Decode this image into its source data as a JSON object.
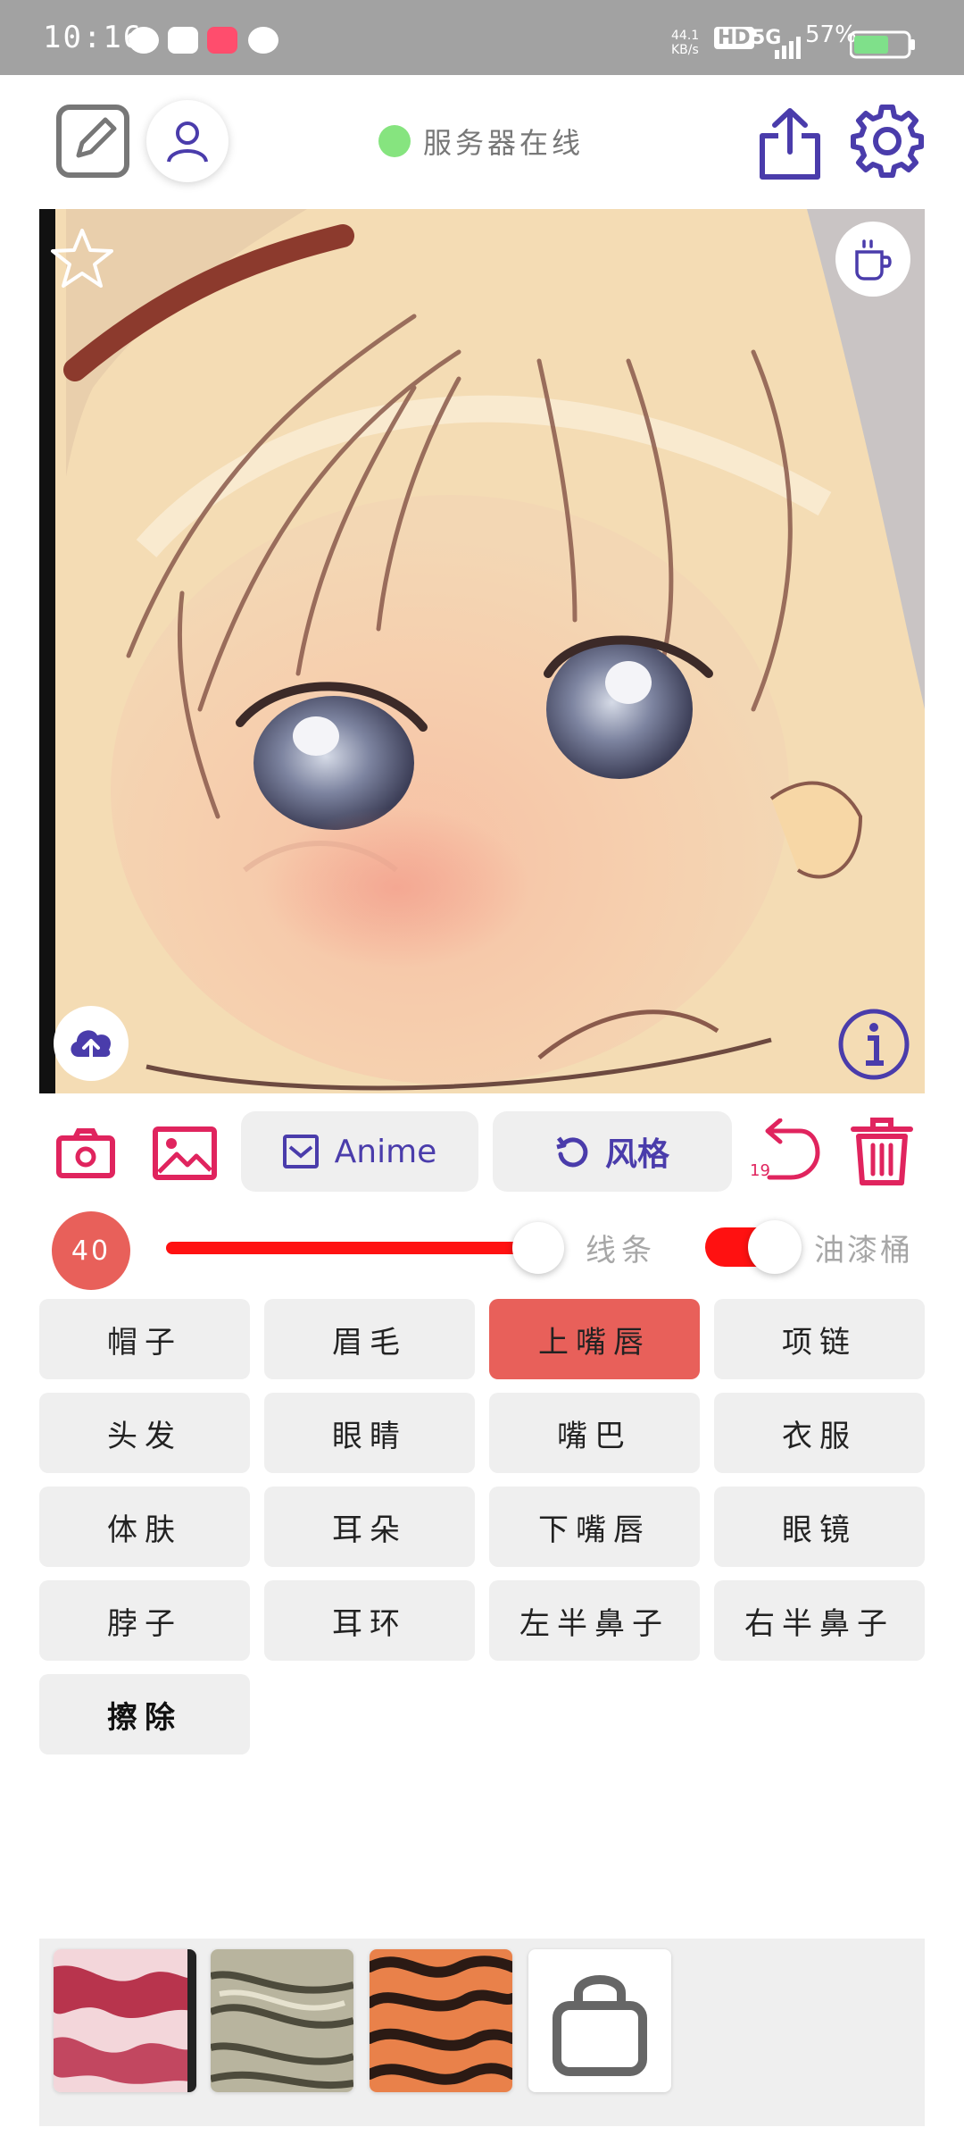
{
  "status_bar": {
    "time": "10:16",
    "net_speed": "44.1\nKB/s",
    "hd": "HD",
    "signal": "5G",
    "battery": "57%"
  },
  "header": {
    "server_status": "服务器在线",
    "colors": {
      "accent": "#4a3cab",
      "online": "#86e47f"
    }
  },
  "toolbar": {
    "model_label": "Anime",
    "style_label": "风格",
    "undo_count": "19",
    "colors": {
      "icon_red": "#e0245e"
    }
  },
  "brush": {
    "size": "40",
    "line_label": "线条",
    "bucket_label": "油漆桶",
    "size_fraction": 0.76,
    "bucket_on": true
  },
  "parts": [
    {
      "label": "帽子"
    },
    {
      "label": "眉毛"
    },
    {
      "label": "上嘴唇"
    },
    {
      "label": "项链"
    },
    {
      "label": "头发"
    },
    {
      "label": "眼睛"
    },
    {
      "label": "嘴巴"
    },
    {
      "label": "衣服"
    },
    {
      "label": "体肤"
    },
    {
      "label": "耳朵"
    },
    {
      "label": "下嘴唇"
    },
    {
      "label": "眼镜"
    },
    {
      "label": "脖子"
    },
    {
      "label": "耳环"
    },
    {
      "label": "左半鼻子"
    },
    {
      "label": "右半鼻子"
    },
    {
      "label": "擦除"
    }
  ],
  "selected_part": "上嘴唇",
  "style_swatches": [
    "pink-marble",
    "olive-marble",
    "tiger-stripes"
  ],
  "icons": [
    "sketch-icon",
    "user-icon",
    "share-icon",
    "gear-icon",
    "star-icon",
    "coffee-icon",
    "cloud-upload-icon",
    "info-icon",
    "camera-icon",
    "image-icon",
    "undo-icon",
    "trash-icon",
    "bag-icon"
  ]
}
